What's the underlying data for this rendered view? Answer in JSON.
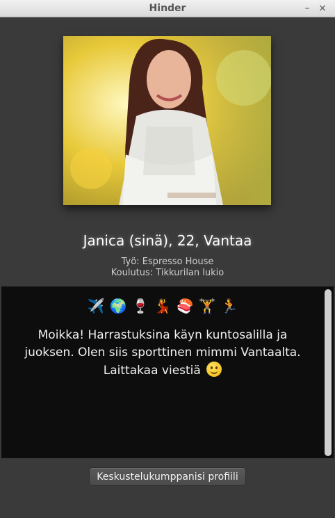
{
  "window": {
    "title": "Hinder",
    "minimize_glyph": "–",
    "close_glyph": "×"
  },
  "profile": {
    "name_line": "Janica (sinä), 22, Vantaa",
    "work": "Työ: Espresso House",
    "school": "Koulutus: Tikkurilan lukio"
  },
  "bio": {
    "interests": [
      {
        "icon": "airplane-icon",
        "glyph": "✈️"
      },
      {
        "icon": "globe-icon",
        "glyph": "🌍"
      },
      {
        "icon": "wine-glass-icon",
        "glyph": "🍷"
      },
      {
        "icon": "dancer-icon",
        "glyph": "💃"
      },
      {
        "icon": "sushi-icon",
        "glyph": "🍣"
      },
      {
        "icon": "weightlifter-icon",
        "glyph": "🏋"
      },
      {
        "icon": "runner-icon",
        "glyph": "🏃"
      }
    ],
    "text": "Moikka! Harrastuksina käyn kuntosalilla ja juoksen. Olen siis sporttinen mimmi Vantaalta. Laittakaa viestiä",
    "trailing_icon": "smiley-icon"
  },
  "actions": {
    "partner_profile_label": "Keskustelukumppanisi profiili"
  }
}
